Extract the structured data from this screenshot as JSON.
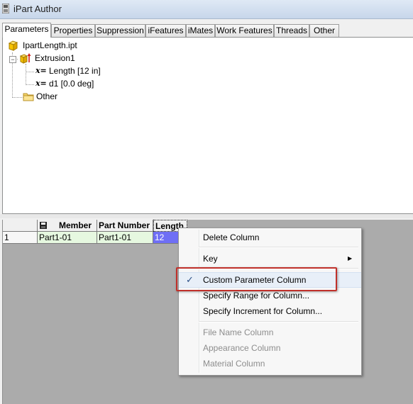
{
  "window": {
    "title": "iPart Author"
  },
  "tabs": [
    {
      "label": "Parameters",
      "active": true
    },
    {
      "label": "Properties"
    },
    {
      "label": "Suppression"
    },
    {
      "label": "iFeatures"
    },
    {
      "label": "iMates"
    },
    {
      "label": "Work Features"
    },
    {
      "label": "Threads"
    },
    {
      "label": "Other"
    }
  ],
  "tree": {
    "root": "IpartLength.ipt",
    "feature": "Extrusion1",
    "params": [
      {
        "symbol": "x=",
        "label": "Length [12 in]"
      },
      {
        "symbol": "x=",
        "label": "d1 [0.0 deg]"
      }
    ],
    "other_folder": "Other"
  },
  "table": {
    "headers": {
      "member": "Member",
      "part_number": "Part Number",
      "length": "Length"
    },
    "rows": [
      {
        "index": "1",
        "member": "Part1-01",
        "part_number": "Part1-01",
        "length": "12"
      }
    ]
  },
  "context_menu": {
    "items": [
      {
        "label": "Delete Column"
      },
      {
        "label": "Key",
        "submenu_arrow": "▶"
      },
      {
        "label": "Custom Parameter Column",
        "checked": true,
        "check": "✓"
      },
      {
        "label": "Specify Range for Column..."
      },
      {
        "label": "Specify Increment for Column..."
      },
      {
        "label": "File Name Column",
        "disabled": true
      },
      {
        "label": "Appearance Column",
        "disabled": true
      },
      {
        "label": "Material Column",
        "disabled": true
      }
    ]
  },
  "colors": {
    "selected_cell": "#6f6ff5",
    "highlight_outline": "#c0302a",
    "grid_background": "#ababab"
  }
}
